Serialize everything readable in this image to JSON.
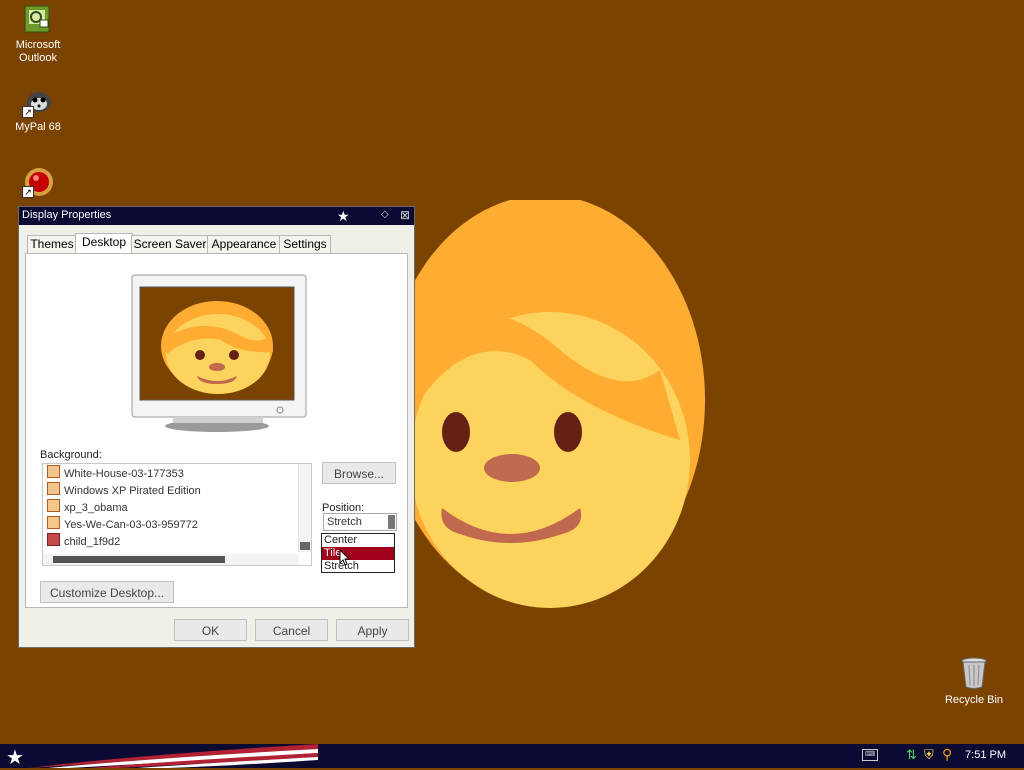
{
  "desktop": {
    "icons": [
      {
        "label": "Microsoft Outlook",
        "icon": "outlook-icon"
      },
      {
        "label": "MyPal 68",
        "icon": "mypal-icon"
      },
      {
        "label": "",
        "icon": "red-ball-app-icon"
      }
    ],
    "recycle_bin_label": "Recycle Bin",
    "colors": {
      "background": "#7b4301",
      "face": "#fbd35d",
      "hair": "#ffac33"
    }
  },
  "window": {
    "title": "Display Properties",
    "tabs": [
      "Themes",
      "Desktop",
      "Screen Saver",
      "Appearance",
      "Settings"
    ],
    "active_tab": "Desktop",
    "background_label": "Background:",
    "backgrounds": [
      {
        "name": "White-House-03-177353",
        "icon": "image-file-icon"
      },
      {
        "name": "Windows XP Pirated Edition",
        "icon": "image-file-icon"
      },
      {
        "name": "xp_3_obama",
        "icon": "image-file-icon"
      },
      {
        "name": "Yes-We-Can-03-03-959772",
        "icon": "image-file-icon"
      },
      {
        "name": "child_1f9d2",
        "icon": "image-file-icon-red"
      }
    ],
    "browse_label": "Browse...",
    "position_label": "Position:",
    "position_value": "Stretch",
    "position_options": [
      "Center",
      "Tile",
      "Stretch"
    ],
    "position_highlighted": "Tile",
    "customize_label": "Customize Desktop...",
    "ok_label": "OK",
    "cancel_label": "Cancel",
    "apply_label": "Apply"
  },
  "taskbar": {
    "clock": "7:51 PM",
    "tray_icons": [
      "keyboard-icon",
      "network-icon",
      "security-shield-icon",
      "search-icon"
    ]
  }
}
